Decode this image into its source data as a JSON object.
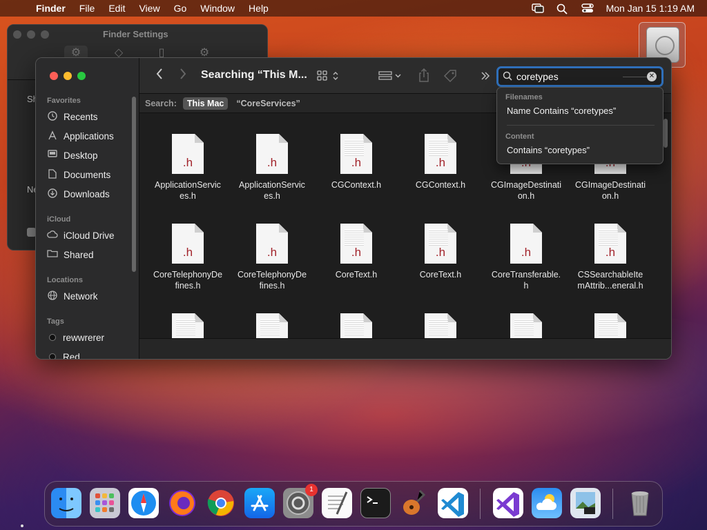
{
  "menubar": {
    "app": "Finder",
    "items": [
      "File",
      "Edit",
      "View",
      "Go",
      "Window",
      "Help"
    ],
    "clock": "Mon Jan 15  1:19 AM"
  },
  "settings_window": {
    "title": "Finder Settings",
    "fragments": [
      "Sh",
      "Ne"
    ]
  },
  "finder": {
    "title": "Searching “This M...",
    "sidebar": {
      "favorites_label": "Favorites",
      "favorites": [
        {
          "label": "Recents",
          "icon": "clock-icon"
        },
        {
          "label": "Applications",
          "icon": "applications-icon"
        },
        {
          "label": "Desktop",
          "icon": "desktop-icon"
        },
        {
          "label": "Documents",
          "icon": "document-icon"
        },
        {
          "label": "Downloads",
          "icon": "download-icon"
        }
      ],
      "icloud_label": "iCloud",
      "icloud": [
        {
          "label": "iCloud Drive",
          "icon": "cloud-icon"
        },
        {
          "label": "Shared",
          "icon": "shared-folder-icon"
        }
      ],
      "locations_label": "Locations",
      "locations": [
        {
          "label": "Network",
          "icon": "globe-icon"
        }
      ],
      "tags_label": "Tags",
      "tags": [
        {
          "label": "rewwrerer"
        },
        {
          "label": "Red"
        }
      ]
    },
    "search": {
      "value": "coretypes",
      "scope_label": "Search:",
      "scope_selected": "This Mac",
      "scope_other": "“CoreServices”"
    },
    "suggestions": {
      "filenames_header": "Filenames",
      "filenames_item": "Name Contains “coretypes”",
      "content_header": "Content",
      "content_item": "Contains “coretypes”"
    },
    "files": [
      {
        "line1": "ApplicationServic",
        "line2": "es.h",
        "ext": ".h"
      },
      {
        "line1": "ApplicationServic",
        "line2": "es.h",
        "ext": ".h"
      },
      {
        "line1": "CGContext.h",
        "line2": "",
        "ext": ".h"
      },
      {
        "line1": "CGContext.h",
        "line2": "",
        "ext": ".h"
      },
      {
        "line1": "CGImageDestinati",
        "line2": "on.h",
        "ext": ".h"
      },
      {
        "line1": "CGImageDestinati",
        "line2": "on.h",
        "ext": ".h"
      },
      {
        "line1": "CoreTelephonyDe",
        "line2": "fines.h",
        "ext": ".h"
      },
      {
        "line1": "CoreTelephonyDe",
        "line2": "fines.h",
        "ext": ".h"
      },
      {
        "line1": "CoreText.h",
        "line2": "",
        "ext": ".h"
      },
      {
        "line1": "CoreText.h",
        "line2": "",
        "ext": ".h"
      },
      {
        "line1": "CoreTransferable.",
        "line2": "h",
        "ext": ".h"
      },
      {
        "line1": "CSSearchableIte",
        "line2": "mAttrib...eneral.h",
        "ext": ".h"
      }
    ]
  },
  "dock": {
    "apps": [
      "finder-icon",
      "launchpad-icon",
      "safari-icon",
      "firefox-icon",
      "chrome-icon",
      "app-store-icon",
      "system-settings-icon",
      "textedit-icon",
      "terminal-icon",
      "garageband-icon",
      "vscode-icon",
      "visual-studio-icon",
      "weather-icon",
      "preview-icon",
      "trash-icon"
    ],
    "settings_badge": "1"
  }
}
